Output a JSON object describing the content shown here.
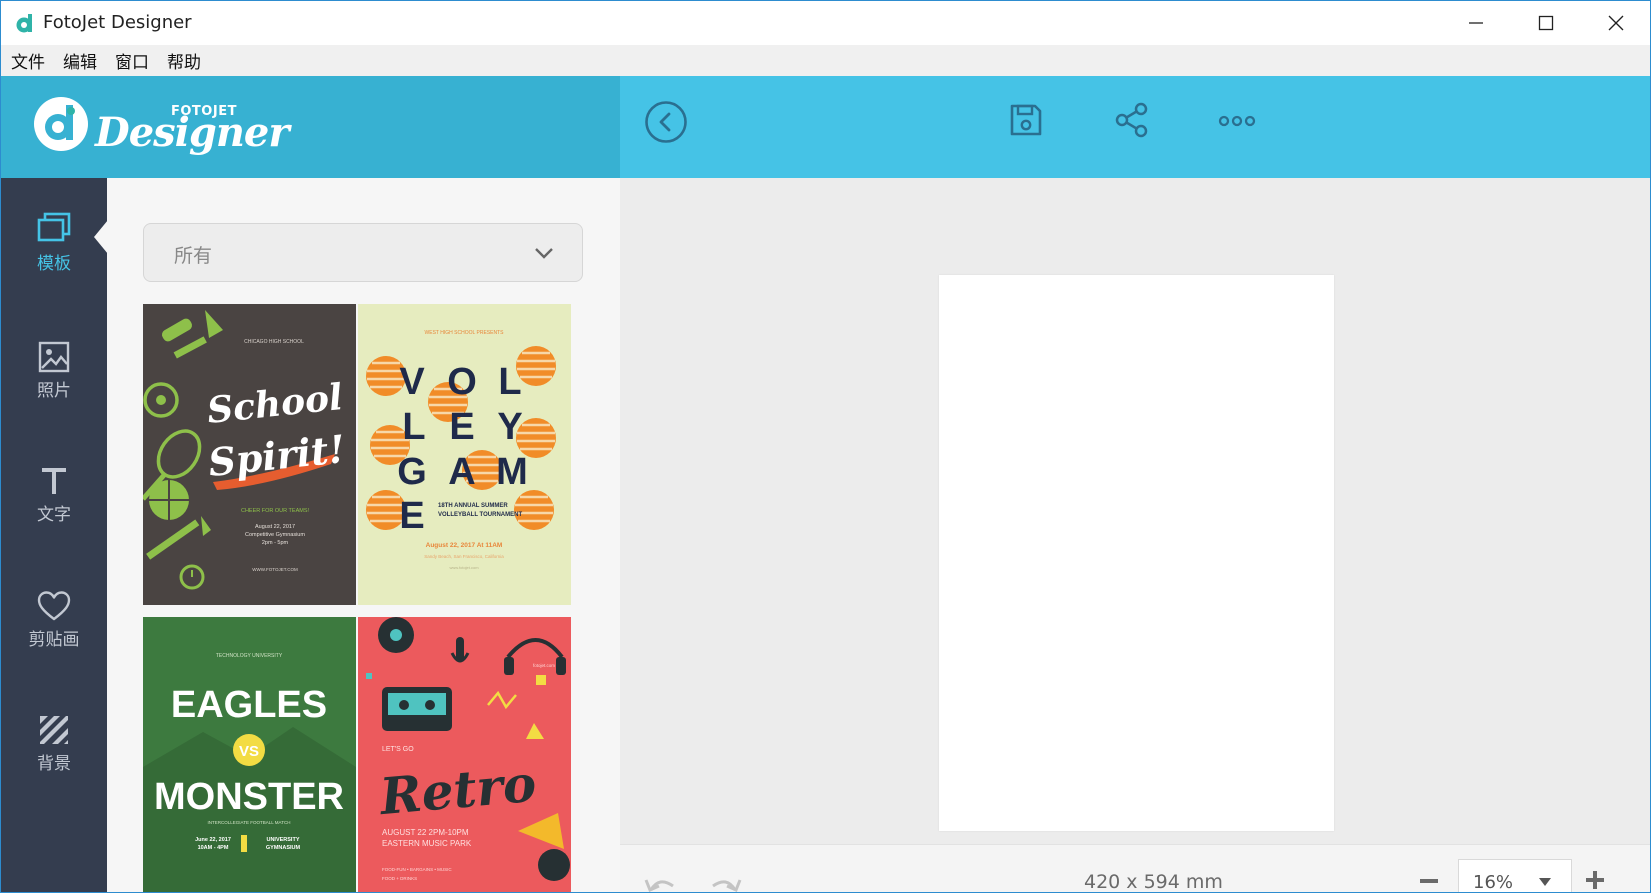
{
  "window": {
    "title": "FotoJet Designer"
  },
  "menu": [
    "文件",
    "编辑",
    "窗口",
    "帮助"
  ],
  "logo": {
    "brand": "FOTOJET",
    "product": "Designer"
  },
  "rail": [
    {
      "label": "模板",
      "icon": "template-icon",
      "active": true
    },
    {
      "label": "照片",
      "icon": "photo-icon",
      "active": false
    },
    {
      "label": "文字",
      "icon": "text-icon",
      "active": false
    },
    {
      "label": "剪贴画",
      "icon": "clipart-heart-icon",
      "active": false
    },
    {
      "label": "背景",
      "icon": "background-stripes-icon",
      "active": false
    }
  ],
  "filter": {
    "selected": "所有"
  },
  "templates": {
    "school": {
      "top": "CHICAGO HIGH SCHOOL",
      "line1": "School",
      "line2": "Spirit!",
      "tag": "CHEER FOR OUR TEAMS!",
      "date": "August 22, 2017",
      "place": "Competitive Gymnasium",
      "time": "2pm - 5pm",
      "url": "WWW.FOTOJET.COM"
    },
    "volley": {
      "top": "WEST HIGH SCHOOL PRESENTS",
      "letters": [
        "V",
        "O",
        "L",
        "L",
        "E",
        "Y",
        "G",
        "A",
        "M",
        "E"
      ],
      "sub1": "18TH ANNUAL SUMMER",
      "sub2": "VOLLEYBALL TOURNAMENT",
      "date": "August 22, 2017 At 11AM",
      "place": "Sandy Beach, San Francisco, California",
      "url": "www.fotojet.com"
    },
    "eagles": {
      "top": "TECHNOLOGY UNIVERSITY",
      "team1": "EAGLES",
      "vs": "VS",
      "team2": "MONSTER",
      "match": "INTERCOLLEGIATE FOOTBALL MATCH",
      "date": "June 22, 2017",
      "time": "10AM - 4PM",
      "venue1": "UNIVERSITY",
      "venue2": "GYMNASIUM"
    },
    "retro": {
      "url": "fotojet.com",
      "letsgo": "LET'S GO",
      "title": "Retro",
      "date": "AUGUST 22 2PM-10PM",
      "place": "EASTERN MUSIC PARK",
      "extra1": "FOOD-FUN • BARGAINS • MUSIC",
      "extra2": "FOOD + DRINKS"
    }
  },
  "canvas": {
    "size": "420 x 594 mm",
    "zoom": "16%"
  },
  "colors": {
    "header_dark": "#37b1d2",
    "header_light": "#45c3e6",
    "rail": "#343d4f",
    "accent": "#45c3e6"
  }
}
